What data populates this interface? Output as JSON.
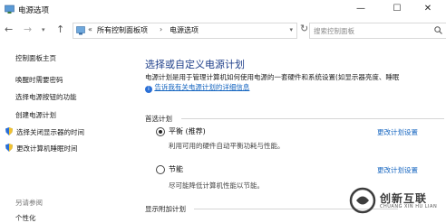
{
  "window": {
    "title": "电源选项",
    "minimize": "—",
    "maximize": "☐",
    "close": "✕"
  },
  "address": {
    "crumb_sep": "«",
    "crumbs": [
      "所有控制面板项",
      "电源选项"
    ],
    "arrow": "›",
    "search_placeholder": "搜索控制面板"
  },
  "sidebar": {
    "home": "控制面板主页",
    "links": [
      "唤醒时需要密码",
      "选择电源按钮的功能",
      "创建电源计划"
    ],
    "icon_links": [
      "选择关闭显示器的时间",
      "更改计算机睡眠时间"
    ],
    "see_also": "另请参阅",
    "personalize": "个性化"
  },
  "main": {
    "heading": "选择或自定义电源计划",
    "description": "电源计划是用于管理计算机如何使用电源的一套硬件和系统设置(如显示器亮度、睡眠",
    "description_link": "告诉我有关电源计划的详细信息",
    "preferred_label": "首选计划",
    "plans": [
      {
        "name": "平衡 (推荐)",
        "desc": "利用可用的硬件自动平衡功耗与性能。",
        "link": "更改计划设置",
        "selected": true
      },
      {
        "name": "节能",
        "desc": "尽可能降低计算机性能以节能。",
        "link": "更改计划设置",
        "selected": false
      }
    ],
    "additional_label": "显示附加计划"
  },
  "watermark": {
    "text": "创新互联",
    "sub": "CHUANG XIN HU LIAN"
  },
  "colors": {
    "link": "#1565c0",
    "heading": "#1e3f8a",
    "shield_blue": "#2a6fd6",
    "shield_yellow": "#f2c230"
  }
}
